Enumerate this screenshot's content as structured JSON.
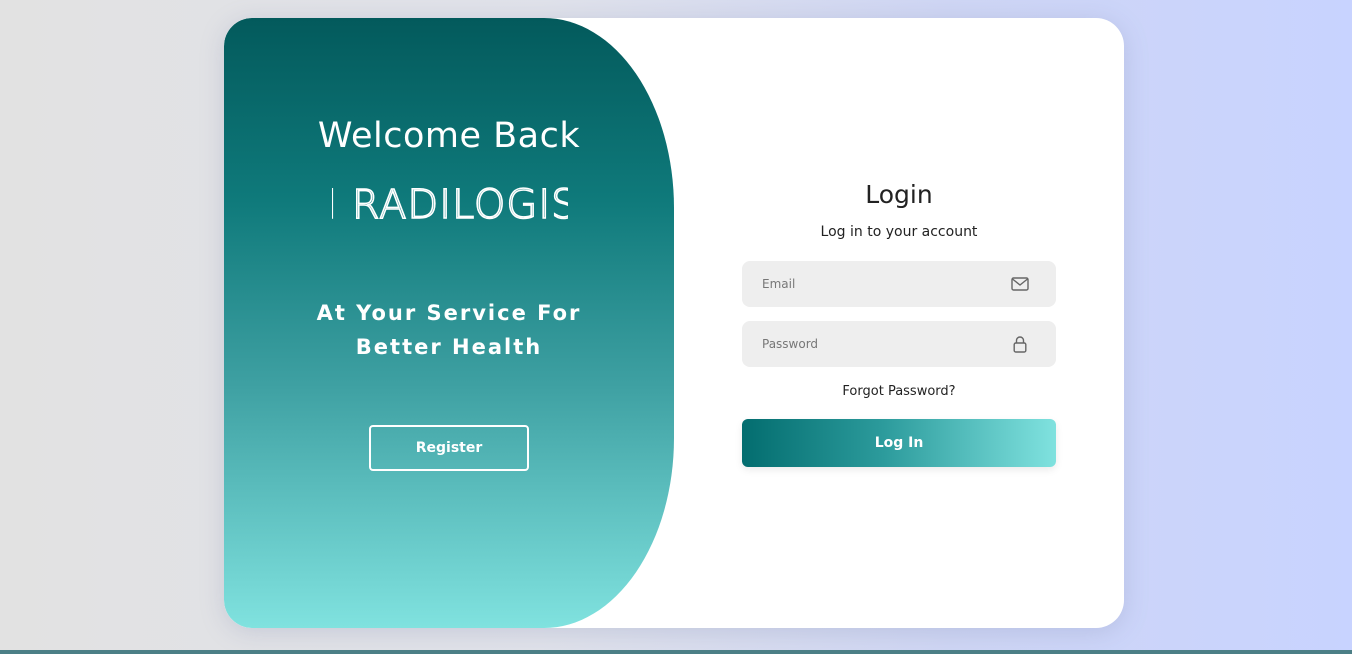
{
  "welcome_panel": {
    "title": "Welcome Back",
    "logo_text": "AI RADILOGIST",
    "tagline_line1": "At Your Service For",
    "tagline_line2": "Better Health",
    "register_label": "Register"
  },
  "login_form": {
    "title": "Login",
    "subtitle": "Log in to your account",
    "email": {
      "placeholder": "Email",
      "value": "",
      "icon": "envelope-icon"
    },
    "password": {
      "placeholder": "Password",
      "value": "",
      "icon": "lock-icon"
    },
    "forgot_label": "Forgot Password?",
    "submit_label": "Log In"
  },
  "colors": {
    "brand_dark": "#035a5c",
    "brand_light": "#80e2df",
    "field_bg": "#eeeeee"
  }
}
